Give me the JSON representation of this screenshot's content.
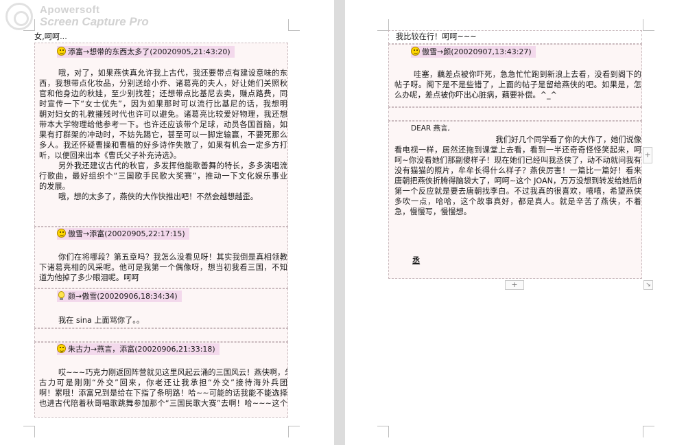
{
  "watermark": {
    "line1": "Apowersoft",
    "line2": "Screen Capture Pro"
  },
  "page1": {
    "top_text": "女,呵呵...",
    "post1": {
      "header": "添富→想带的东西太多了(20020905,21:43:20)",
      "lines": [
        "哦，对了，如果燕侠真允许我上古代，我还要带点有建设意味的东",
        "西，我想带点化妆品，分别送给小乔、诸葛亮的夫人，好让她们关照秋",
        "官和他身边的秋娃，至少别找茬；还想带点比基尼去卖，赚点路费，同",
        "时宣传一下“女士优先”，因为如果那时可以流行比基尼的话，我想明",
        "朝对妇女的礼教摧残时代也许可以避免。诸葛亮比较爱好物理，我还想",
        "带本大学物理给他参考一下。也许还应该带个足球，动员各国首脑，如",
        "果有打群架的冲动时，不妨先踢它，甚至可以一脚定输赢，不要死那么",
        "多人。我还怀疑曹操和曹植的好多诗作失散了，如果有机会一定多方打",
        "听，以便回来出本《曹氏父子补充诗选》。",
        "另外我还建议古代的秋官，多发挥他能歌善舞的特长，多多演唱流",
        "行歌曲，最好组织个“三国歌手民歌大奖赛”，推动一下文化娱乐事业",
        "的发展。",
        "哦，想的太多了，燕侠的大作快推出吧！不然会越想越歪。"
      ]
    },
    "post2": {
      "header": "傲雪→添富(20020905,22:17:15)",
      "lines": [
        "你们在将哪段？第五章吗？我怎么没看见呀！其实我倒是真相领教",
        "下诸葛亮相的风采呢。他可是我第一个偶像呀，想当初我看三国，不知",
        "道为他掉了多少眼泪呢。呵呵"
      ]
    },
    "post3": {
      "header": "颜→傲雪(20020906,18:34:34)",
      "lines": [
        "我在 sina 上面骂你了。。"
      ]
    },
    "post4": {
      "header": "朱古力→燕言，添富(20020906,21:33:18)",
      "lines": [
        "哎~~~巧克力刚返回阵营就见这里风起云涌的三国风云！燕侠啊，朱",
        "古力可是刚刚“外交”回来，你老还让我承担“外交”接待海外兵团",
        "啊！累哦！添富兄到是给在下指了条明路！哈~~可能的话我能不能选择",
        "也进古代陪着秋哥唱歌跳舞参加那个“三国民歌大赛”去啊！哈~~~这个"
      ]
    }
  },
  "page2": {
    "top_text": "我比较在行！呵呵~~~",
    "post1": {
      "header": "傲雪→颜(20020907,13:43:27)",
      "lines": [
        "哇塞，藕差点被你吓死，急急忙忙跑到新浪上去看，没看到阁下的",
        "帖子呀。阁下是不是些错了，上面的帖子是留给燕侠的吧。如果是，怎",
        "么办呢，差点被你吓出心脏病，藕要补偿。^_^"
      ]
    },
    "letter": {
      "salutation": "DEAR 燕言,",
      "lines": [
        "我们好几个同学看了你的大作了，她们说像",
        "看电视一样，居然还拖到课堂上去看，看到一半还奇奇怪怪笑起来，呵",
        "呵~你没看她们那副傻样子！现在她们已经叫我丞侠了，动不动就问我有",
        "没有猫猫的照片，牟牟长得什么样子？燕侠厉害！一篇比一篇好！看来",
        "唐朝把燕侠折腾得脑袋大了，呵呵~这个 JOAN，万万没想到转发给她后的",
        "第一个反应就是要去唐朝找李白。不过我真的很喜欢，嘻嘻，希望燕侠",
        "多吹一点，哈哈，这个故事真好，都是真人。就是辛苦了燕侠，不着",
        "急，慢慢写，慢慢想。"
      ],
      "signature": "丞"
    },
    "add_row_symbol": "+",
    "add_col_symbol": "+"
  }
}
